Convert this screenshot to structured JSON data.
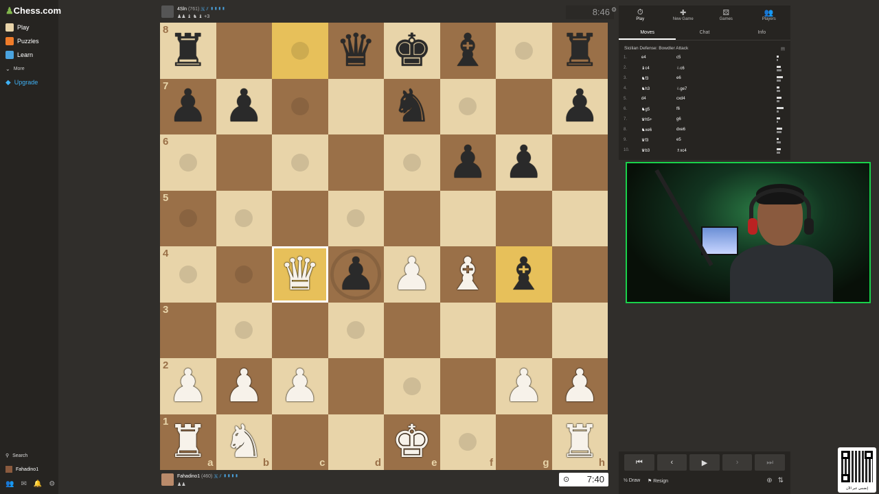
{
  "sidebar": {
    "logo_text": "Chess.com",
    "items": [
      {
        "label": "Play",
        "icon": "play-icon",
        "color": "#e8d4a9"
      },
      {
        "label": "Puzzles",
        "icon": "puzzle-icon",
        "color": "#f07c2a"
      },
      {
        "label": "Learn",
        "icon": "learn-icon",
        "color": "#4aa3df"
      },
      {
        "label": "More",
        "icon": "chevron-down-icon",
        "color": "#aaa"
      },
      {
        "label": "Upgrade",
        "icon": "diamond-icon",
        "color": "#3fb1f5"
      }
    ],
    "search_label": "Search",
    "username": "Fahadino1"
  },
  "opponent": {
    "name": "4Sln",
    "rating": "(761)",
    "flags": "🇳 ⫽ ▮▮▮▮",
    "captured": "♟♟ ♝ ♞ ♝ +3",
    "clock": "8:46"
  },
  "player": {
    "name": "Fahadino1",
    "rating": "(460)",
    "flags": "🇳 ⫽ ▮▮▮▮",
    "captured": "♟♟",
    "clock": "7:40",
    "clock_icon": "⊙"
  },
  "board": {
    "ranks": [
      "8",
      "7",
      "6",
      "5",
      "4",
      "3",
      "2",
      "1"
    ],
    "files": [
      "a",
      "b",
      "c",
      "d",
      "e",
      "f",
      "g",
      "h"
    ],
    "position": [
      [
        "bR",
        "",
        "",
        "bQ",
        "bK",
        "bB",
        "",
        "bR"
      ],
      [
        "bP",
        "bP",
        "",
        "",
        "bN",
        "",
        "",
        "bP"
      ],
      [
        "",
        "",
        "",
        "",
        "",
        "bP",
        "bP",
        ""
      ],
      [
        "",
        "",
        "",
        "",
        "",
        "",
        "",
        ""
      ],
      [
        "",
        "",
        "wQ",
        "bP",
        "wP",
        "wB",
        "bB",
        ""
      ],
      [
        "",
        "",
        "",
        "",
        "",
        "",
        "",
        ""
      ],
      [
        "wP",
        "wP",
        "wP",
        "",
        "",
        "",
        "wP",
        "wP"
      ],
      [
        "wR",
        "wN",
        "",
        "",
        "wK",
        "",
        "",
        "wR"
      ]
    ],
    "highlights": [
      "c8",
      "g4",
      "c4"
    ],
    "selected": "c4",
    "dots": [
      "c8",
      "g8",
      "c7",
      "f7",
      "a6",
      "c6",
      "e6",
      "a5",
      "b5",
      "d5",
      "a4",
      "b4",
      "b3",
      "d3",
      "e2",
      "f1"
    ],
    "rings": [
      "d4"
    ]
  },
  "panel": {
    "tabs": [
      {
        "label": "Play",
        "icon": "⏱"
      },
      {
        "label": "New Game",
        "icon": "✚"
      },
      {
        "label": "Games",
        "icon": "⚄"
      },
      {
        "label": "Players",
        "icon": "👥"
      }
    ],
    "subtabs": [
      "Moves",
      "Chat",
      "Info"
    ],
    "opening": "Sicilian Defense: Bowdler Attack",
    "moves": [
      {
        "n": "1.",
        "w": "e4",
        "b": "c5"
      },
      {
        "n": "2.",
        "w": "♝c4",
        "b": "♘c6"
      },
      {
        "n": "3.",
        "w": "♞f3",
        "b": "e6"
      },
      {
        "n": "4.",
        "w": "♞h3",
        "b": "♘ge7"
      },
      {
        "n": "5.",
        "w": "d4",
        "b": "cxd4"
      },
      {
        "n": "6.",
        "w": "♞g5",
        "b": "f6"
      },
      {
        "n": "7.",
        "w": "♛h5+",
        "b": "g6"
      },
      {
        "n": "8.",
        "w": "♞xe6",
        "b": "dxe6"
      },
      {
        "n": "9.",
        "w": "♛f3",
        "b": "e5"
      },
      {
        "n": "10.",
        "w": "♛b3",
        "b": "♗xc4"
      }
    ]
  },
  "controls": {
    "nav": [
      "⏮",
      "‹",
      "▶",
      "›",
      "⏭"
    ],
    "draw_label": "Draw",
    "draw_icon": "½",
    "resign_label": "Resign",
    "resign_icon": "⚑"
  },
  "qr": {
    "caption": "إنضمي عبر الآن"
  }
}
